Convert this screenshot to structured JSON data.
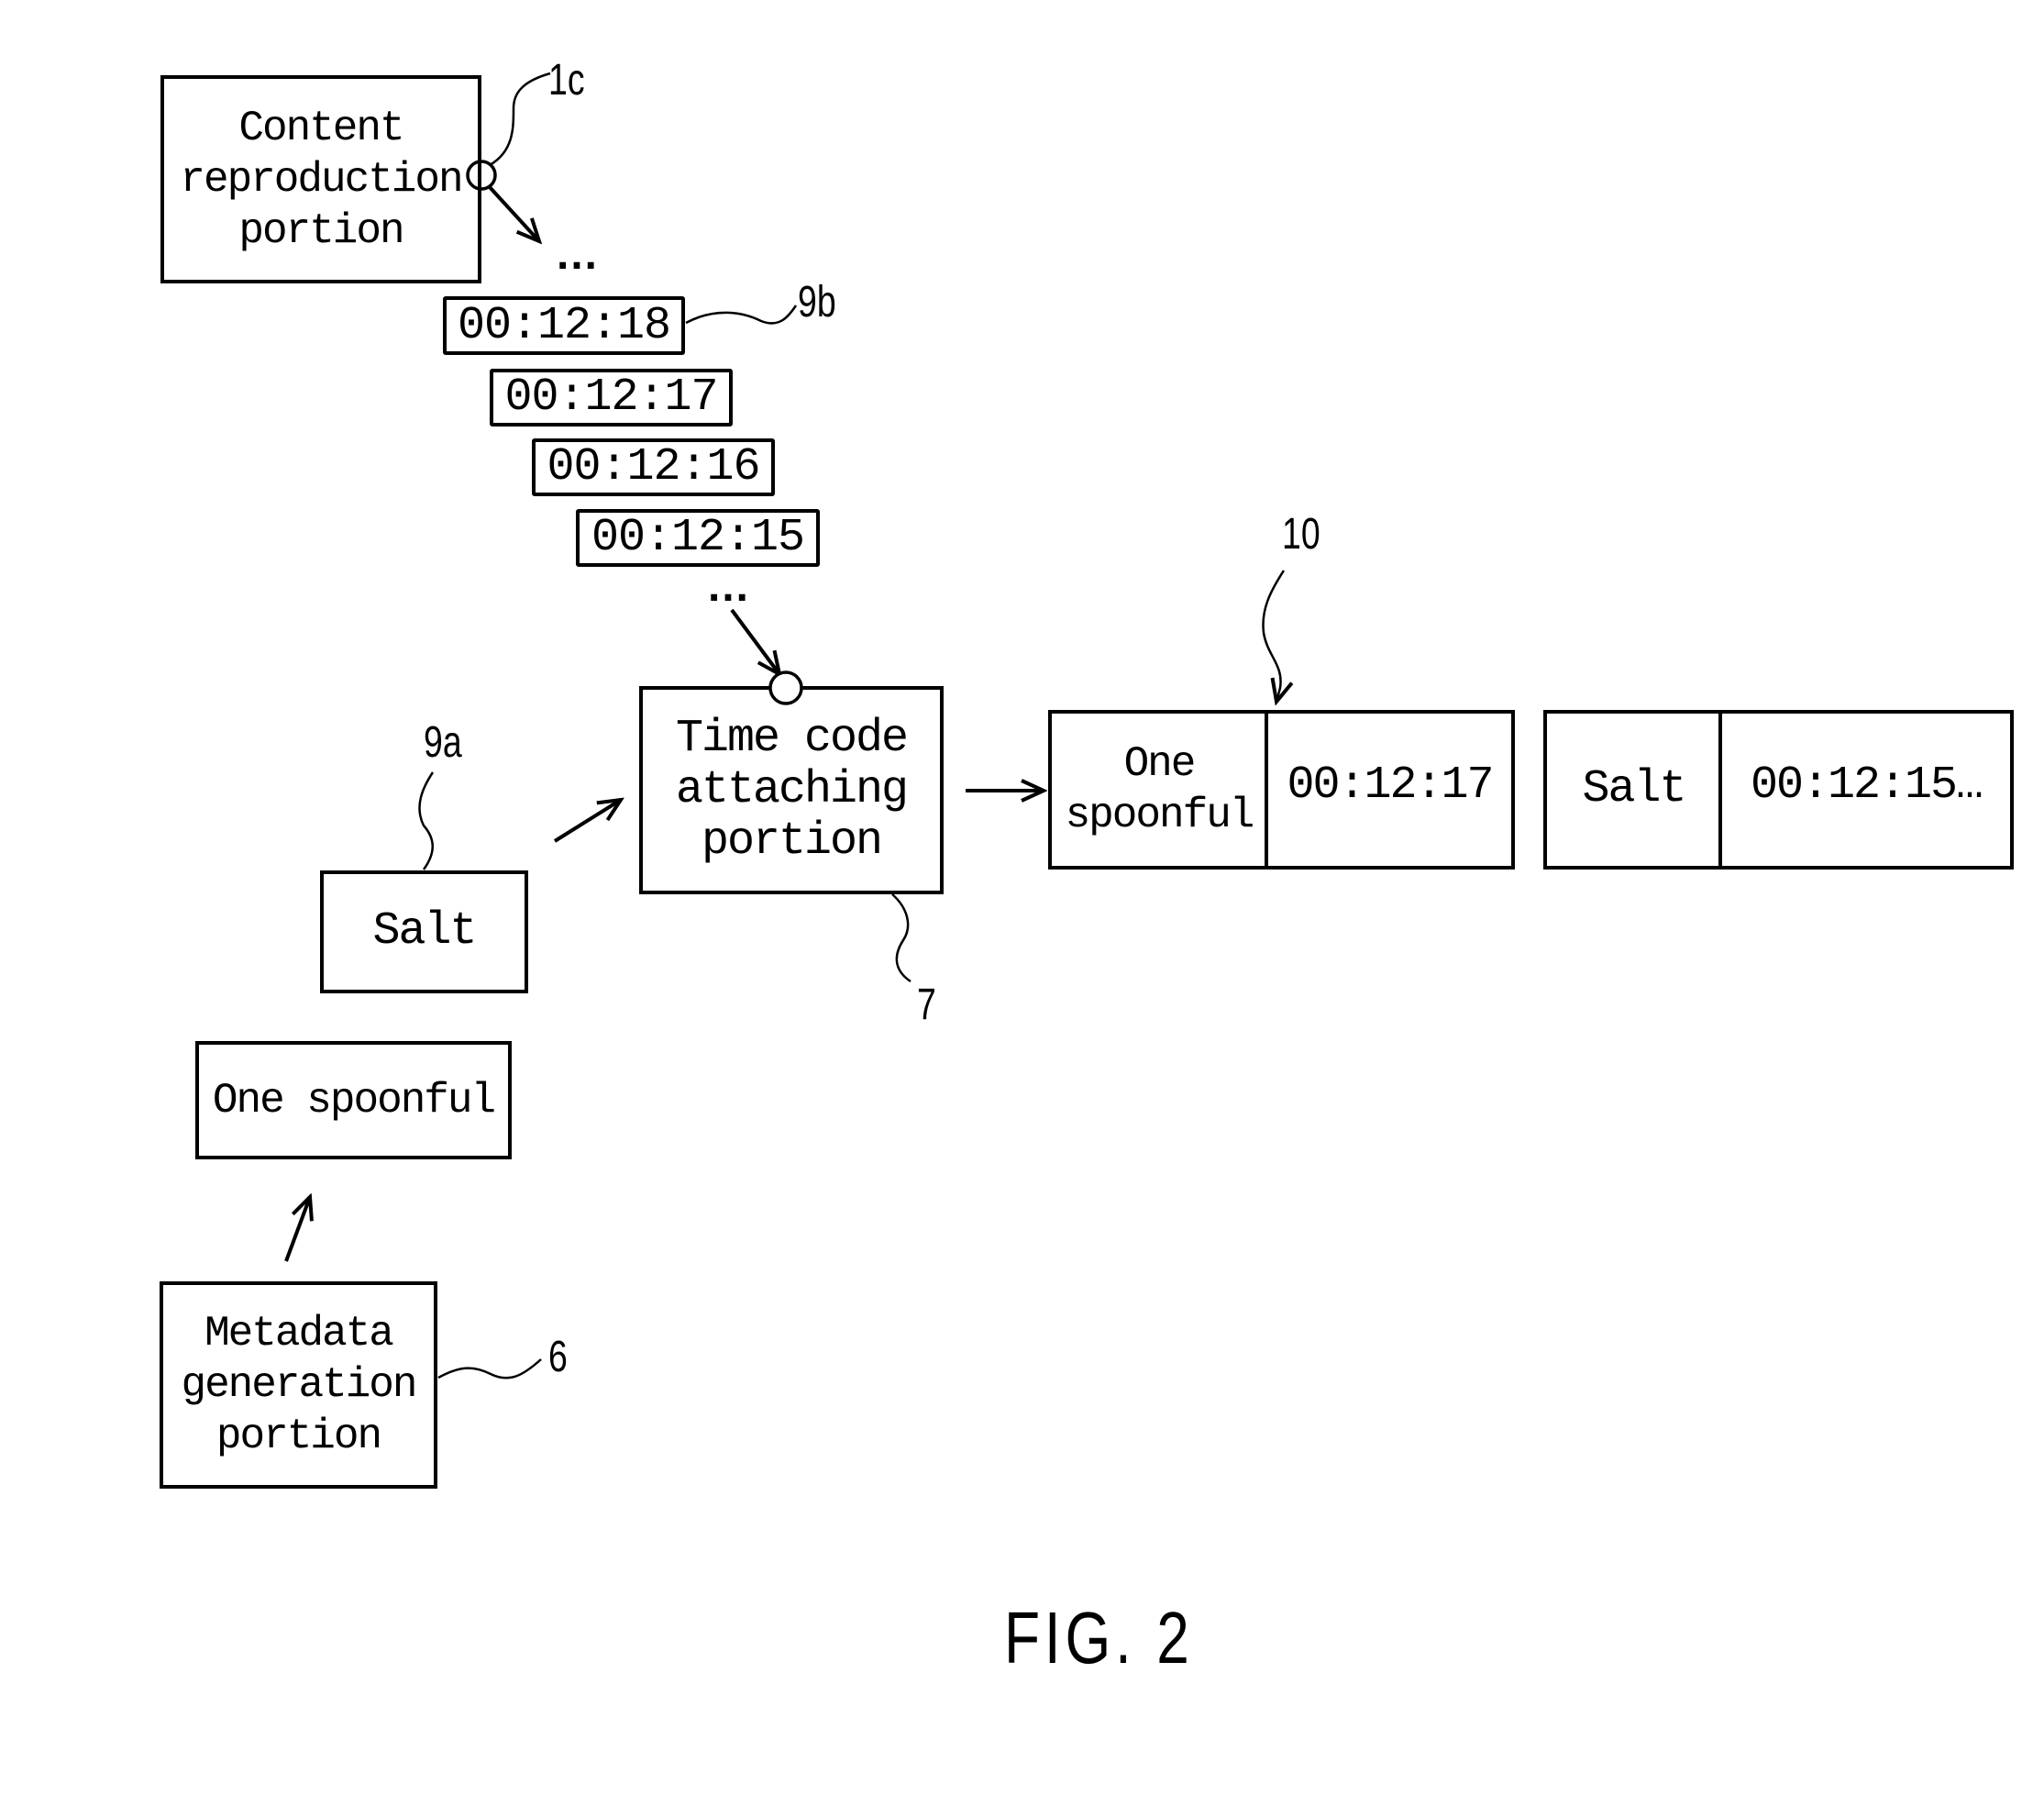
{
  "figure": {
    "caption": "FIG. 2",
    "blocks": {
      "content_reproduction": {
        "label": "Content\nreproduction\nportion",
        "ref": "1c"
      },
      "time_code_attaching": {
        "label": "Time code\nattaching\nportion",
        "ref": "7"
      },
      "metadata_generation": {
        "label": "Metadata\ngeneration\nportion",
        "ref": "6"
      }
    },
    "time_codes": {
      "ref": "9b",
      "ellipsis_top": "…",
      "ellipsis_bottom": "…",
      "items": [
        "00:12:18",
        "00:12:17",
        "00:12:16",
        "00:12:15"
      ]
    },
    "metadata_items": {
      "ref": "9a",
      "items": [
        "Salt",
        "One spoonful"
      ]
    },
    "output_records": {
      "ref": "10",
      "records": [
        {
          "metadata": "One\nspoonful",
          "time_code": "00:12:17"
        },
        {
          "metadata": "Salt",
          "time_code": "00:12:15…"
        }
      ]
    }
  }
}
